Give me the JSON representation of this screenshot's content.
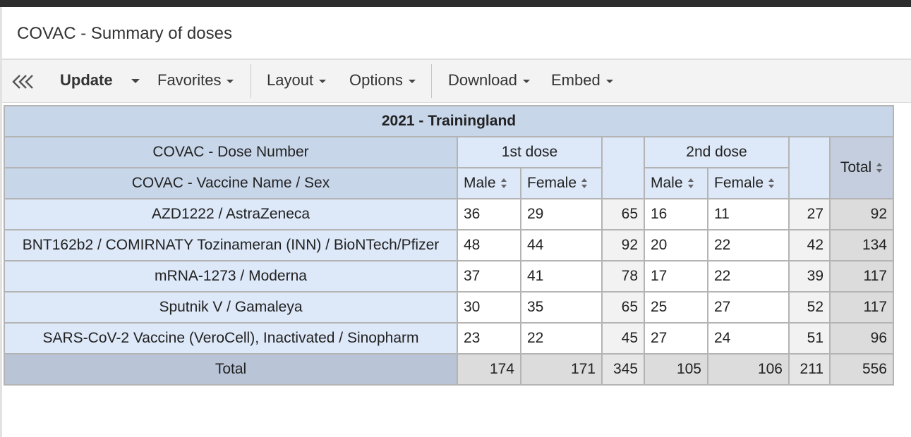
{
  "window": {
    "title": "COVAC - Summary of doses"
  },
  "toolbar": {
    "collapse_icon": "triple-chevron-left-icon",
    "update_label": "Update",
    "favorites_label": "Favorites",
    "layout_label": "Layout",
    "options_label": "Options",
    "download_label": "Download",
    "embed_label": "Embed"
  },
  "table": {
    "caption": "2021 - Trainingland",
    "dim_column_header": "COVAC - Dose Number",
    "dim_row_header": "COVAC - Vaccine Name / Sex",
    "dose_groups": [
      "1st dose",
      "2nd dose"
    ],
    "sex_headers": [
      "Male",
      "Female",
      "Male",
      "Female"
    ],
    "total_header": "Total",
    "rows": [
      {
        "label": "AZD1222 / AstraZeneca",
        "d1_male": "36",
        "d1_female": "29",
        "d1_subtotal": "65",
        "d2_male": "16",
        "d2_female": "11",
        "d2_subtotal": "27",
        "total": "92"
      },
      {
        "label": "BNT162b2 / COMIRNATY Tozinameran (INN) / BioNTech/Pfizer",
        "d1_male": "48",
        "d1_female": "44",
        "d1_subtotal": "92",
        "d2_male": "20",
        "d2_female": "22",
        "d2_subtotal": "42",
        "total": "134"
      },
      {
        "label": "mRNA-1273 / Moderna",
        "d1_male": "37",
        "d1_female": "41",
        "d1_subtotal": "78",
        "d2_male": "17",
        "d2_female": "22",
        "d2_subtotal": "39",
        "total": "117"
      },
      {
        "label": "Sputnik V / Gamaleya",
        "d1_male": "30",
        "d1_female": "35",
        "d1_subtotal": "65",
        "d2_male": "25",
        "d2_female": "27",
        "d2_subtotal": "52",
        "total": "117"
      },
      {
        "label": "SARS-CoV-2 Vaccine (VeroCell), Inactivated / Sinopharm",
        "d1_male": "23",
        "d1_female": "22",
        "d1_subtotal": "45",
        "d2_male": "27",
        "d2_female": "24",
        "d2_subtotal": "51",
        "total": "96"
      }
    ],
    "footer": {
      "label": "Total",
      "d1_male": "174",
      "d1_female": "171",
      "d1_subtotal": "345",
      "d2_male": "105",
      "d2_female": "106",
      "d2_subtotal": "211",
      "total": "556"
    },
    "sort_icon": "sort-arrows-icon"
  },
  "colors": {
    "header_bg": "#c8d6ea",
    "subheader_bg": "#dde8f8",
    "total_bg": "#dcdcdc",
    "toolbar_bg": "#f3f3f3"
  }
}
